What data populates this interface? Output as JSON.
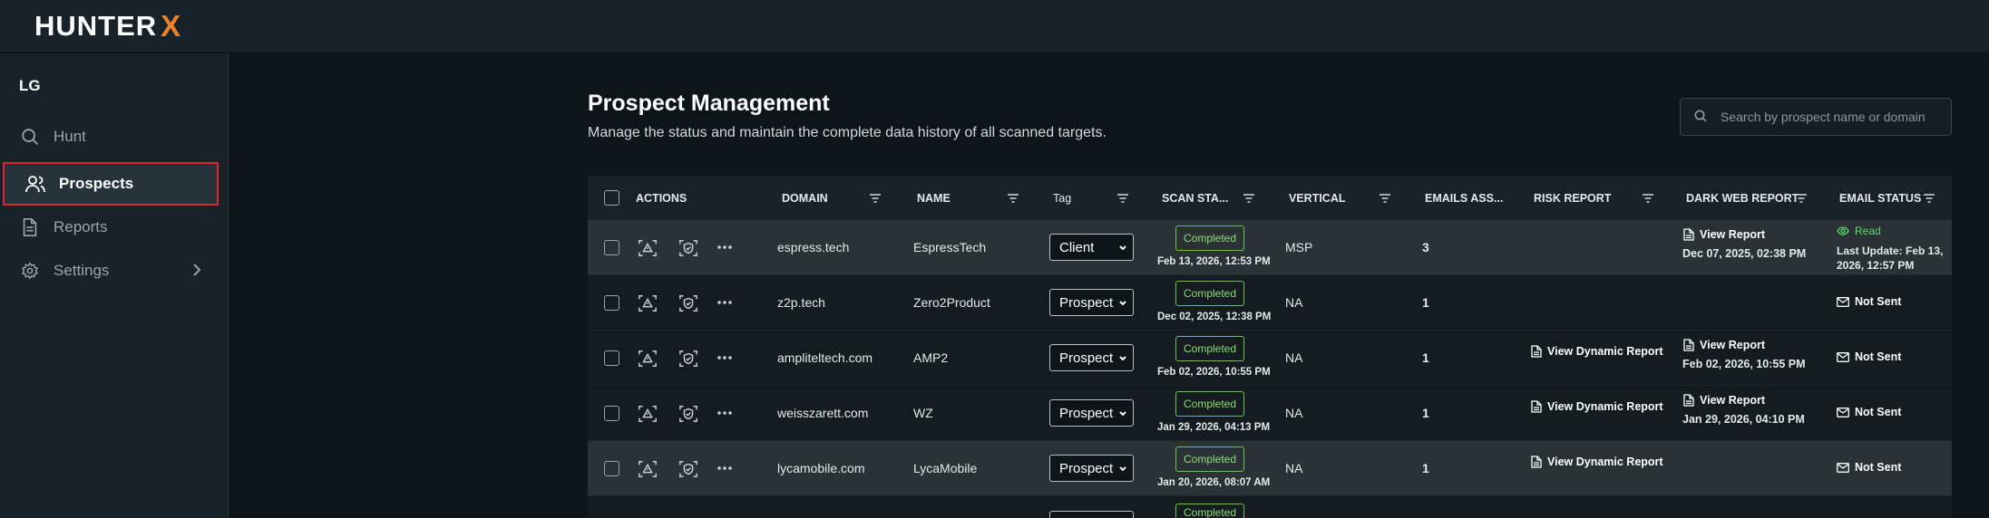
{
  "app": {
    "logo_text": "HUNTER",
    "logo_mark": "X",
    "accent_color": "#e8832a"
  },
  "sidebar": {
    "user_initials": "LG",
    "items": [
      {
        "label": "Hunt",
        "icon": "search-icon",
        "active": false
      },
      {
        "label": "Prospects",
        "icon": "users-icon",
        "active": true
      },
      {
        "label": "Reports",
        "icon": "document-icon",
        "active": false
      },
      {
        "label": "Settings",
        "icon": "gear-icon",
        "active": false,
        "has_submenu": true
      }
    ]
  },
  "page": {
    "title": "Prospect Management",
    "subtitle": "Manage the status and maintain the complete data history of all scanned targets.",
    "search_placeholder": "Search by prospect name or domain"
  },
  "table": {
    "headers": {
      "actions": "ACTIONS",
      "domain": "DOMAIN",
      "name": "NAME",
      "tag": "Tag",
      "scan_status": "SCAN STA...",
      "vertical": "VERTICAL",
      "emails": "EMAILS ASS...",
      "risk_report": "RISK REPORT",
      "dark_web_report": "DARK WEB REPORT",
      "email_status": "EMAIL STATUS"
    },
    "rows": [
      {
        "domain": "espress.tech",
        "name": "EspressTech",
        "tag": "Client",
        "scan_status": "Completed",
        "scan_date": "Feb 13, 2026, 12:53 PM",
        "vertical": "MSP",
        "emails": "3",
        "risk_report": "",
        "dark_web_label": "View Report",
        "dark_web_date": "Dec 07, 2025, 02:38 PM",
        "email_status": "Read",
        "email_last_update": "Last Update: Feb 13, 2026, 12:57 PM"
      },
      {
        "domain": "z2p.tech",
        "name": "Zero2Product",
        "tag": "Prospect",
        "scan_status": "Completed",
        "scan_date": "Dec 02, 2025, 12:38 PM",
        "vertical": "NA",
        "emails": "1",
        "risk_report": "",
        "dark_web_label": "",
        "dark_web_date": "",
        "email_status": "Not Sent",
        "email_last_update": ""
      },
      {
        "domain": "ampliteltech.com",
        "name": "AMP2",
        "tag": "Prospect",
        "scan_status": "Completed",
        "scan_date": "Feb 02, 2026, 10:55 PM",
        "vertical": "NA",
        "emails": "1",
        "risk_report": "View Dynamic Report",
        "dark_web_label": "View Report",
        "dark_web_date": "Feb 02, 2026, 10:55 PM",
        "email_status": "Not Sent",
        "email_last_update": ""
      },
      {
        "domain": "weisszarett.com",
        "name": "WZ",
        "tag": "Prospect",
        "scan_status": "Completed",
        "scan_date": "Jan 29, 2026, 04:13 PM",
        "vertical": "NA",
        "emails": "1",
        "risk_report": "View Dynamic Report",
        "dark_web_label": "View Report",
        "dark_web_date": "Jan 29, 2026, 04:10 PM",
        "email_status": "Not Sent",
        "email_last_update": ""
      },
      {
        "domain": "lycamobile.com",
        "name": "LycaMobile",
        "tag": "Prospect",
        "scan_status": "Completed",
        "scan_date": "Jan 20, 2026, 08:07 AM",
        "vertical": "NA",
        "emails": "1",
        "risk_report": "View Dynamic Report",
        "dark_web_label": "",
        "dark_web_date": "",
        "email_status": "Not Sent",
        "email_last_update": ""
      }
    ],
    "partial_row_status": "Completed"
  }
}
